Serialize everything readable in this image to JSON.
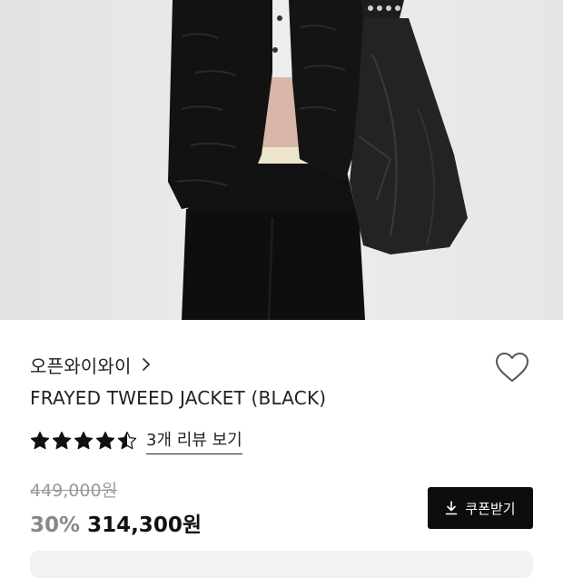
{
  "product": {
    "brand": "오픈와이와이",
    "title": "FRAYED TWEED JACKET (BLACK)",
    "rating_value": 4.5,
    "rating_max": 5,
    "review_link": "3개 리뷰 보기",
    "original_price": "449,000원",
    "discount_rate": "30%",
    "sale_price": "314,300원"
  },
  "actions": {
    "coupon_label": "쿠폰받기",
    "wishlist_icon": "heart-outline-icon",
    "coupon_icon": "download-icon",
    "brand_chevron_icon": "chevron-right-icon"
  },
  "colors": {
    "background": "#ffffff",
    "text": "#222222",
    "muted": "#9a9a9a",
    "discount": "#888888",
    "button_bg": "#0d0d0d",
    "button_text": "#ffffff",
    "panel": "#f2f2f2"
  }
}
